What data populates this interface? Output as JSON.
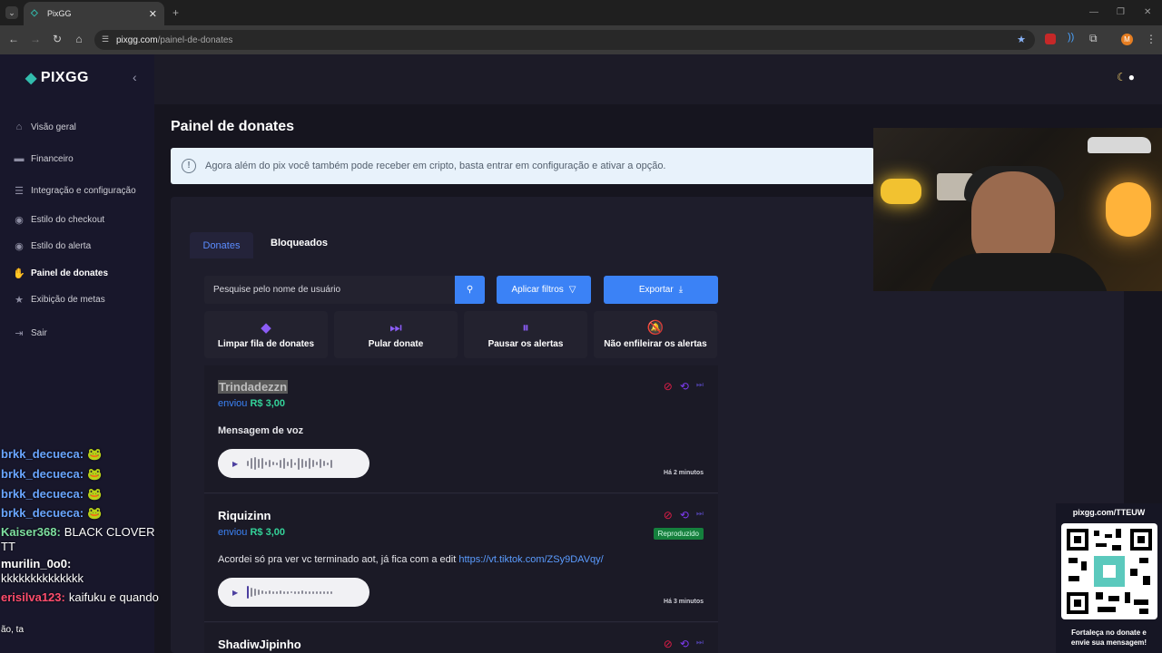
{
  "browser": {
    "tab_title": "PixGG",
    "url_host": "pixgg.com",
    "url_path": "/painel-de-donates",
    "profile_initial": "M"
  },
  "app": {
    "logo_text": "PIXGG",
    "brand_color": "#32bcad",
    "accent_color": "#3b82f6"
  },
  "sidebar": {
    "items": [
      {
        "label": "Visão geral",
        "icon": "home-icon"
      },
      {
        "label": "Financeiro",
        "icon": "wallet-icon"
      },
      {
        "label": "Integração e configuração",
        "icon": "settings-icon"
      },
      {
        "label": "Estilo do checkout",
        "icon": "palette-icon"
      },
      {
        "label": "Estilo do alerta",
        "icon": "palette-icon"
      },
      {
        "label": "Painel de donates",
        "icon": "hand-heart-icon",
        "active": true
      },
      {
        "label": "Exibição de metas",
        "icon": "star-icon"
      },
      {
        "label": "Sair",
        "icon": "logout-icon"
      }
    ]
  },
  "page": {
    "title": "Painel de donates",
    "notice": "Agora além do pix você também pode receber em cripto, basta entrar em configuração e ativar a opção."
  },
  "tabs": {
    "donates": "Donates",
    "bloqueados": "Bloqueados"
  },
  "toolbar": {
    "search_placeholder": "Pesquise pelo nome de usuário",
    "filters_label": "Aplicar filtros",
    "export_label": "Exportar"
  },
  "actions": [
    {
      "label": "Limpar fila de donates",
      "icon": "eraser-icon"
    },
    {
      "label": "Pular donate",
      "icon": "skip-icon"
    },
    {
      "label": "Pausar os alertas",
      "icon": "pause-icon"
    },
    {
      "label": "Não enfileirar os alertas",
      "icon": "bell-off-icon"
    }
  ],
  "donates": [
    {
      "name": "Trindadezzn",
      "sent_label": "enviou",
      "amount": "R$ 3,00",
      "message": "Mensagem de voz",
      "time": "Há 2 minutos",
      "badge": ""
    },
    {
      "name": "Riquizinn",
      "sent_label": "enviou",
      "amount": "R$ 3,00",
      "message": "Acordei só pra ver vc terminado aot, já fica com a edit",
      "link": "https://vt.tiktok.com/ZSy9DAVqy/",
      "time": "Há 3 minutos",
      "badge": "Reproduzido"
    },
    {
      "name": "ShadiwJipinho"
    }
  ],
  "chat": [
    {
      "user": "brkk_decueca:",
      "message": "",
      "color": "#6aa6ff"
    },
    {
      "user": "brkk_decueca:",
      "message": "",
      "color": "#6aa6ff"
    },
    {
      "user": "brkk_decueca:",
      "message": "",
      "color": "#6aa6ff"
    },
    {
      "user": "brkk_decueca:",
      "message": "",
      "color": "#6aa6ff"
    },
    {
      "user": "Kaiser368:",
      "message": "BLACK CLOVER",
      "color": "#7ee0a0"
    },
    {
      "user": "",
      "message": "TT",
      "color": "#ffffff"
    },
    {
      "user": "murilin_0o0:",
      "message": "",
      "color": "#ffffff"
    },
    {
      "user": "",
      "message": "kkkkkkkkkkkkkk",
      "color": "#ffffff"
    },
    {
      "user": "erisilva123:",
      "message": "kaifuku e quando",
      "color": "#ff4d6d"
    },
    {
      "user": "",
      "message": "ão, ta",
      "color": "#ffffff"
    }
  ],
  "qr_overlay": {
    "url": "pixgg.com/TTEUW",
    "caption_1": "Fortaleça no donate e",
    "caption_2": "envie sua mensagem!"
  }
}
